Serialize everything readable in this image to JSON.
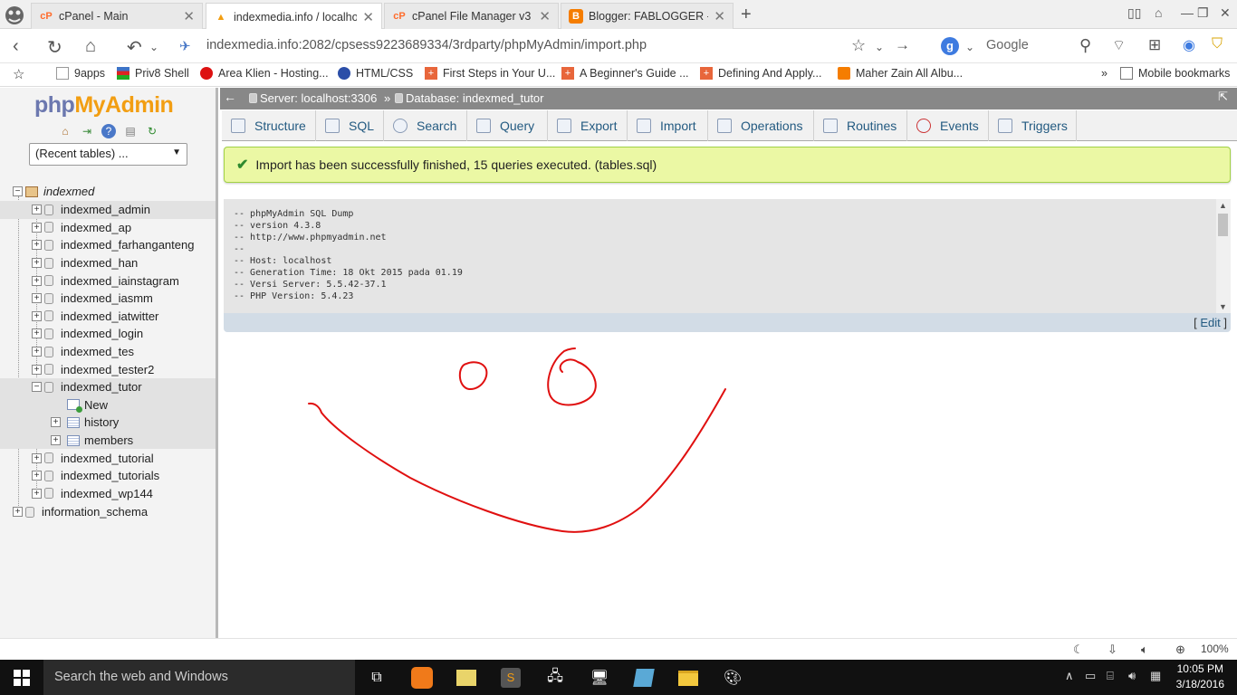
{
  "browser": {
    "tabs": [
      {
        "title": "cPanel - Main",
        "favicon": "cpanel-icon",
        "active": false
      },
      {
        "title": "indexmedia.info / localho",
        "favicon": "phpmyadmin-icon",
        "active": true
      },
      {
        "title": "cPanel File Manager v3",
        "favicon": "cpanel-icon",
        "active": false
      },
      {
        "title": "Blogger: FABLOGGER - Bu",
        "favicon": "blogger-icon",
        "active": false
      }
    ],
    "url": "indexmedia.info:2082/cpsess9223689334/3rdparty/phpMyAdmin/import.php",
    "search_engine_letter": "g",
    "search_placeholder": "Google",
    "bookmarks": [
      {
        "label": "9apps"
      },
      {
        "label": "Priv8 Shell"
      },
      {
        "label": "Area Klien - Hosting..."
      },
      {
        "label": "HTML/CSS"
      },
      {
        "label": "First Steps in Your U..."
      },
      {
        "label": "A Beginner's Guide ..."
      },
      {
        "label": "Defining And Apply..."
      },
      {
        "label": "Maher Zain All Albu..."
      }
    ],
    "bookmarks_overflow": "»",
    "mobile_bookmarks": "Mobile bookmarks",
    "zoom": "100%"
  },
  "pma": {
    "logo_php": "php",
    "logo_myadmin": "MyAdmin",
    "recent_tables": "(Recent tables) ...",
    "tree": {
      "root": "indexmed",
      "databases": [
        "indexmed_admin",
        "indexmed_ap",
        "indexmed_farhanganteng",
        "indexmed_han",
        "indexmed_iainstagram",
        "indexmed_iasmm",
        "indexmed_iatwitter",
        "indexmed_login",
        "indexmed_tes",
        "indexmed_tester2",
        "indexmed_tutor"
      ],
      "tutor_children": [
        "New",
        "history",
        "members"
      ],
      "databases_after": [
        "indexmed_tutorial",
        "indexmed_tutorials",
        "indexmed_wp144"
      ],
      "other_db": "information_schema"
    },
    "breadcrumb": {
      "server": "Server: localhost:3306",
      "separator": "»",
      "database": "Database: indexmed_tutor"
    },
    "tabs": [
      "Structure",
      "SQL",
      "Search",
      "Query",
      "Export",
      "Import",
      "Operations",
      "Routines",
      "Events",
      "Triggers"
    ],
    "success_message": "Import has been successfully finished, 15 queries executed. (tables.sql)",
    "sql_dump": "-- phpMyAdmin SQL Dump\n-- version 4.3.8\n-- http://www.phpmyadmin.net\n--\n-- Host: localhost\n-- Generation Time: 18 Okt 2015 pada 01.19\n-- Versi Server: 5.5.42-37.1\n-- PHP Version: 5.4.23",
    "edit_open": "[",
    "edit_label": "Edit",
    "edit_close": "]"
  },
  "taskbar": {
    "search_placeholder": "Search the web and Windows",
    "time": "10:05 PM",
    "date": "3/18/2016"
  },
  "colors": {
    "success_bg": "#ebf8a4",
    "success_border": "#a2d246",
    "tab_text": "#235a81",
    "drawing_stroke": "#e01010"
  }
}
